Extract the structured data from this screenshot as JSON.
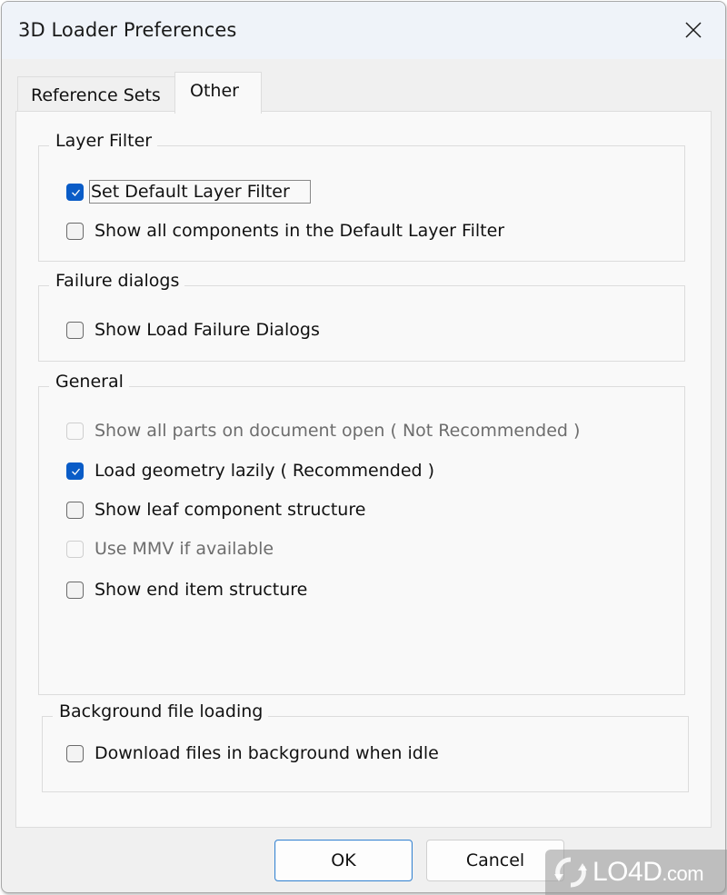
{
  "window": {
    "title": "3D Loader Preferences",
    "close_icon": "close-icon"
  },
  "tabs": [
    {
      "label": "Reference Sets",
      "active": false
    },
    {
      "label": "Other",
      "active": true
    }
  ],
  "groups": {
    "layer_filter": {
      "legend": "Layer Filter",
      "options": [
        {
          "label": "Set Default Layer Filter",
          "checked": true,
          "enabled": true,
          "focused": true
        },
        {
          "label": "Show all components in the Default Layer Filter",
          "checked": false,
          "enabled": true
        }
      ]
    },
    "failure_dialogs": {
      "legend": "Failure dialogs",
      "options": [
        {
          "label": "Show Load Failure Dialogs",
          "checked": false,
          "enabled": true
        }
      ]
    },
    "general": {
      "legend": "General",
      "options": [
        {
          "label": "Show all parts on document open ( Not Recommended )",
          "checked": false,
          "enabled": false
        },
        {
          "label": "Load geometry lazily ( Recommended )",
          "checked": true,
          "enabled": true
        },
        {
          "label": "Show leaf component structure",
          "checked": false,
          "enabled": true
        },
        {
          "label": "Use MMV if available",
          "checked": false,
          "enabled": false
        },
        {
          "label": "Show end item structure",
          "checked": false,
          "enabled": true
        }
      ]
    },
    "background_loading": {
      "legend": "Background file loading",
      "options": [
        {
          "label": "Download files in background when idle",
          "checked": false,
          "enabled": true
        }
      ]
    }
  },
  "buttons": {
    "ok": "OK",
    "cancel": "Cancel"
  },
  "watermark": {
    "brand": "LO4D",
    "suffix": ".com"
  },
  "colors": {
    "accent": "#0a5cc7",
    "titlebar": "#eff3f9",
    "panel": "#f9f9f9",
    "dialog": "#f0f0f0"
  }
}
